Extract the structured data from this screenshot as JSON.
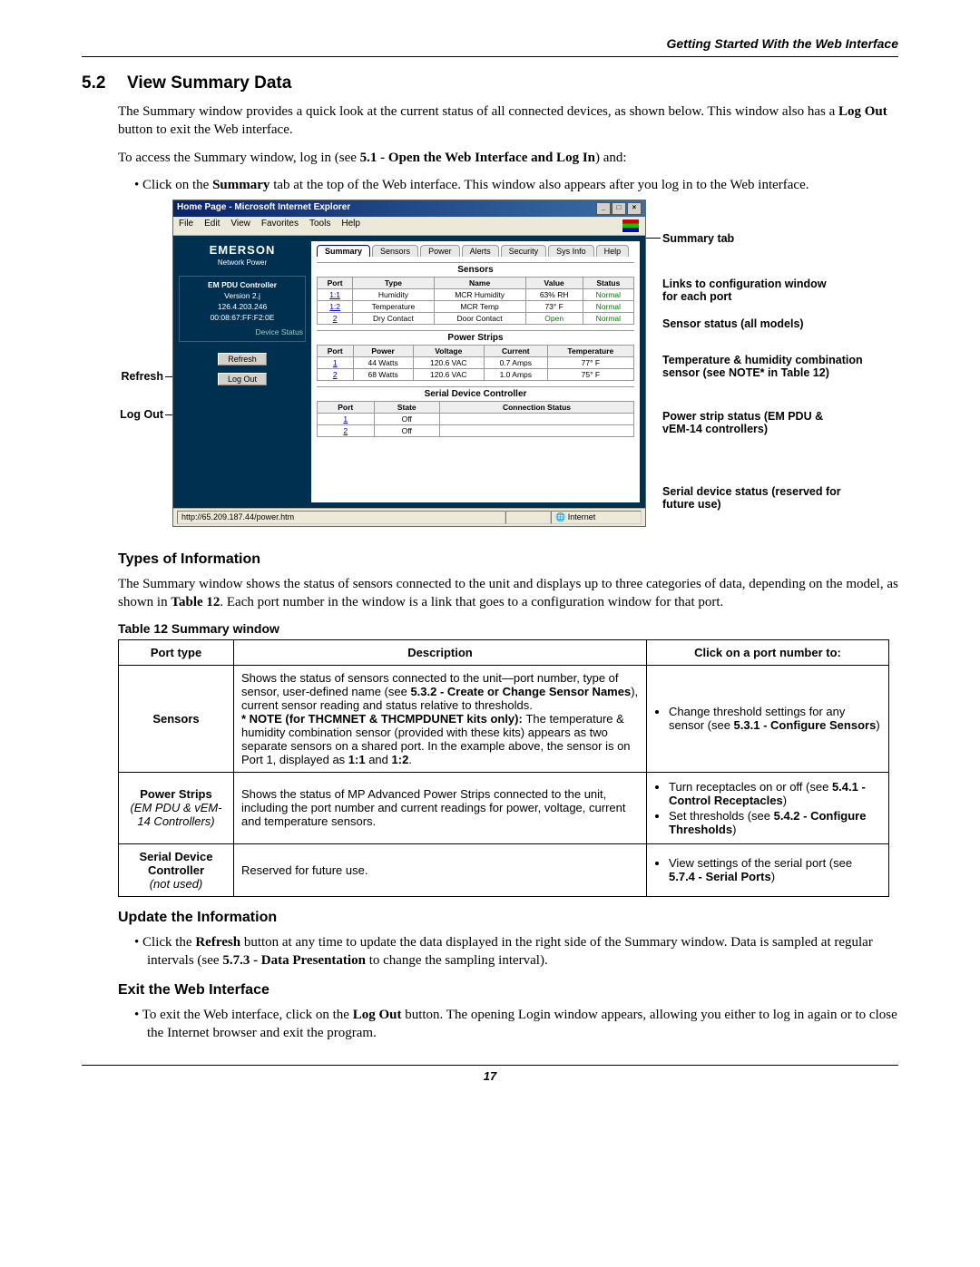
{
  "header_right": "Getting Started With the Web Interface",
  "section_number": "5.2",
  "section_title": "View Summary Data",
  "intro1": "The Summary window provides a quick look at the current status of all connected devices, as shown below. This window also has a ",
  "intro1b": "Log Out",
  "intro1c": " button to exit the Web interface.",
  "intro2a": "To access the Summary window, log in (see ",
  "intro2b": "5.1 - Open the Web Interface and Log In",
  "intro2c": ") and:",
  "bullet1a": "Click on the ",
  "bullet1b": "Summary",
  "bullet1c": " tab at the top of the Web interface. This window also appears after you log in to the Web interface.",
  "callouts": {
    "refresh": "Refresh",
    "logout": "Log Out",
    "summary_tab": "Summary tab",
    "links": "Links to configuration window for each port",
    "sensor": "Sensor status (all models)",
    "temphum": "Temperature & humidity combination sensor (see NOTE* in Table 12)",
    "powerstrip": "Power strip status (EM PDU & vEM-14 controllers)",
    "serial": "Serial device status (reserved for future use)"
  },
  "fig": {
    "title": "Home Page - Microsoft Internet Explorer",
    "menus": [
      "File",
      "Edit",
      "View",
      "Favorites",
      "Tools",
      "Help"
    ],
    "logo": "EMERSON",
    "logo_sub": "Network Power",
    "sidebox_title": "EM PDU Controller",
    "version": "Version 2.j",
    "ip": "126.4.203.246",
    "mac": "00:08:67:FF:F2:0E",
    "devstat": "Device Status",
    "refresh_btn": "Refresh",
    "logout_btn": "Log Out",
    "tabs": [
      "Summary",
      "Sensors",
      "Power",
      "Alerts",
      "Security",
      "Sys Info",
      "Help"
    ],
    "sensors_title": "Sensors",
    "sensors_headers": [
      "Port",
      "Type",
      "Name",
      "Value",
      "Status"
    ],
    "sensors_rows": [
      [
        "1:1",
        "Humidity",
        "MCR Humidity",
        "63% RH",
        "Normal"
      ],
      [
        "1:2",
        "Temperature",
        "MCR Temp",
        "73° F",
        "Normal"
      ],
      [
        "2",
        "Dry Contact",
        "Door Contact",
        "Open",
        "Normal"
      ]
    ],
    "power_title": "Power Strips",
    "power_headers": [
      "Port",
      "Power",
      "Voltage",
      "Current",
      "Temperature"
    ],
    "power_rows": [
      [
        "1",
        "44 Watts",
        "120.6 VAC",
        "0.7 Amps",
        "77° F"
      ],
      [
        "2",
        "68 Watts",
        "120.6 VAC",
        "1.0 Amps",
        "75° F"
      ]
    ],
    "serial_title": "Serial Device Controller",
    "serial_headers": [
      "Port",
      "State",
      "Connection Status"
    ],
    "serial_rows": [
      [
        "1",
        "Off",
        ""
      ],
      [
        "2",
        "Off",
        ""
      ]
    ],
    "url": "http://65.209.187.44/power.htm",
    "zone": "Internet"
  },
  "types_heading": "Types of Information",
  "types_para_a": "The Summary window shows the status of sensors connected to the unit and displays up to three categories of data, depending on the model, as shown in ",
  "types_para_b": "Table 12",
  "types_para_c": ". Each port number in the window is a link that goes to a configuration window for that port.",
  "table_caption": "Table 12    Summary window",
  "table_headers": [
    "Port type",
    "Description",
    "Click on a port number to:"
  ],
  "row1": {
    "col1": "Sensors",
    "desc_a": "Shows the status of sensors connected to the unit—port number, type of sensor, user-defined name (see ",
    "desc_b": "5.3.2 - Create or Change Sensor Names",
    "desc_c": "), current sensor reading and status relative to thresholds.",
    "note_a": "* NOTE (for THCMNET & THCMPDUNET kits only): ",
    "note_b": "The temperature & humidity combination sensor (provided with these kits) appears as two separate sensors on a shared port. In the example above, the sensor is on Port 1, displayed as ",
    "note_c": "1:1",
    "note_d": " and ",
    "note_e": "1:2",
    "note_f": ".",
    "col3_a": "Change threshold settings for any sensor (see ",
    "col3_b": "5.3.1 - Configure Sensors",
    "col3_c": ")"
  },
  "row2": {
    "col1a": "Power Strips",
    "col1b": "(EM PDU & vEM-14 Controllers)",
    "desc": "Shows the status of MP Advanced Power Strips connected to the unit, including the port number and current readings for power, voltage, current and temperature sensors.",
    "b1a": "Turn receptacles on or off (see ",
    "b1b": "5.4.1 - Control Receptacles",
    "b1c": ")",
    "b2a": "Set thresholds (see ",
    "b2b": "5.4.2 - Configure Thresholds",
    "b2c": ")"
  },
  "row3": {
    "col1a": "Serial Device Controller",
    "col1b": "(not used)",
    "desc": "Reserved for future use.",
    "c3a": "View settings of the serial port (see ",
    "c3b": "5.7.4 - Serial Ports",
    "c3c": ")"
  },
  "update_heading": "Update the Information",
  "update_a": "Click the ",
  "update_b": "Refresh",
  "update_c": " button at any time to update the data displayed in the right side of the Summary window. Data is sampled at regular intervals (see ",
  "update_d": "5.7.3 - Data Presentation",
  "update_e": " to change the sampling interval).",
  "exit_heading": "Exit the Web Interface",
  "exit_a": "To exit the Web interface, click on the ",
  "exit_b": "Log Out",
  "exit_c": " button. The opening Login window appears, allowing you either to log in again or to close the Internet browser and exit the program.",
  "page_number": "17"
}
